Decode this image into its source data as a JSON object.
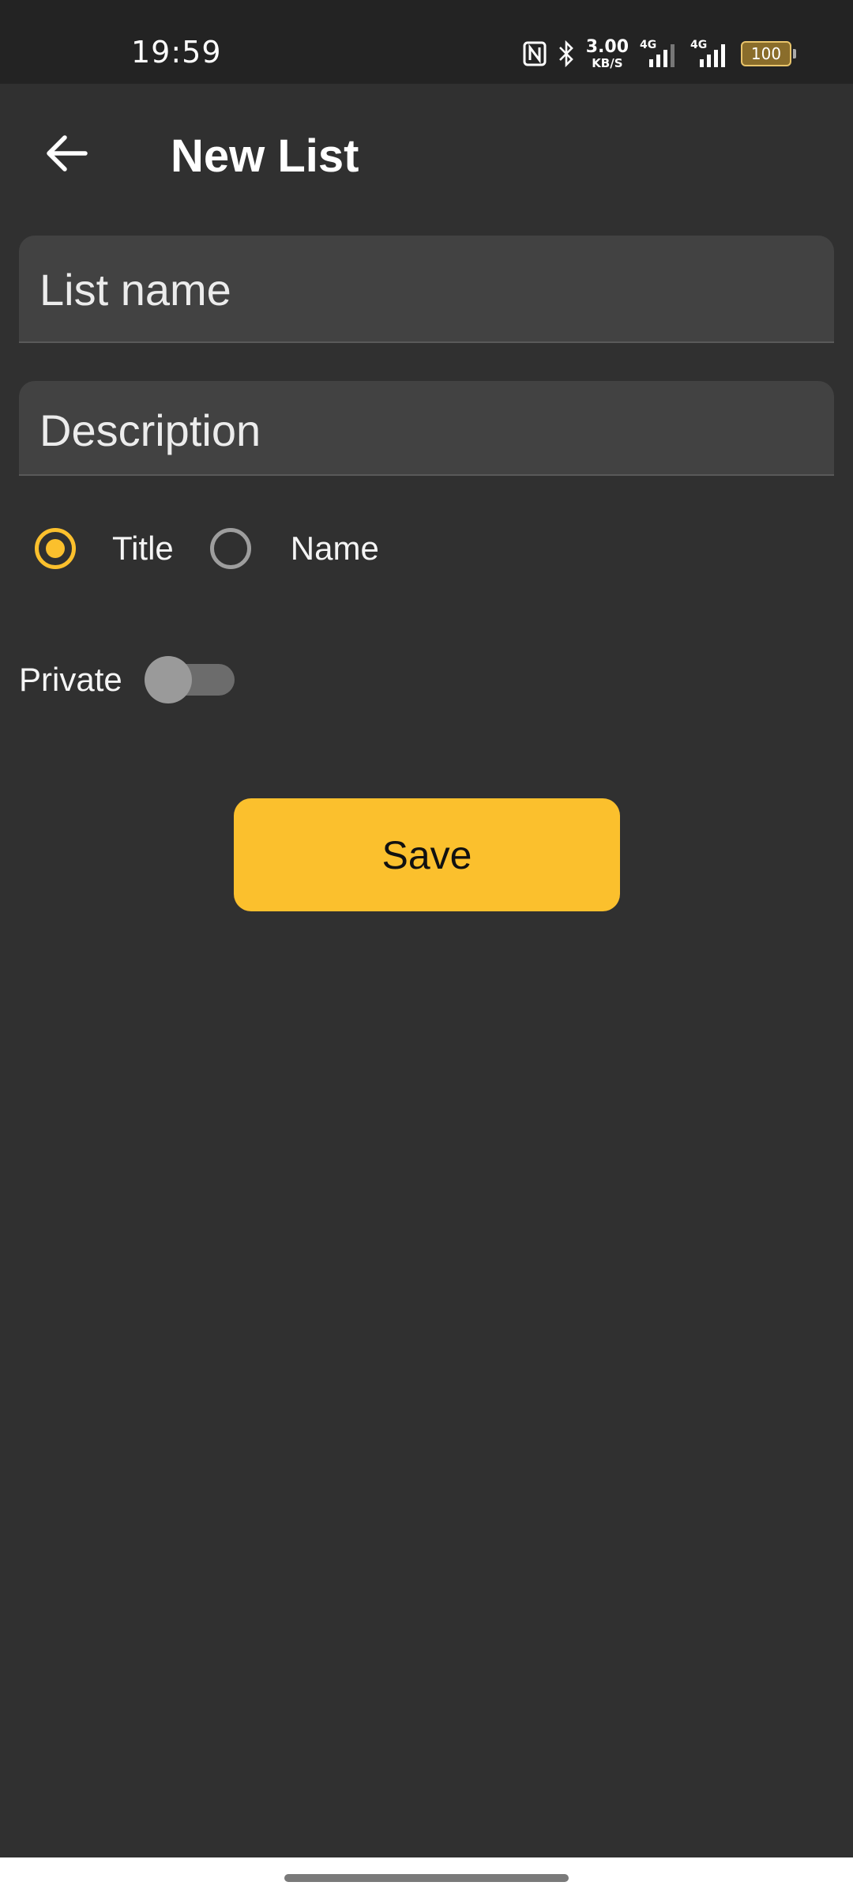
{
  "status_bar": {
    "time": "19:59",
    "net_speed_value": "3.00",
    "net_speed_unit": "KB/S",
    "sim1_gen": "4G",
    "sim2_gen": "4G",
    "battery_level": "100",
    "icons": [
      "nfc-icon",
      "bluetooth-icon",
      "data-arrows-icon",
      "signal-icon",
      "signal-icon",
      "battery-icon"
    ]
  },
  "app_bar": {
    "title": "New List",
    "back_icon": "arrow-left-icon"
  },
  "form": {
    "list_name_placeholder": "List name",
    "description_placeholder": "Description",
    "sort_options": [
      {
        "label": "Title",
        "selected": true
      },
      {
        "label": "Name",
        "selected": false
      }
    ],
    "private_label": "Private",
    "private_on": false,
    "save_label": "Save"
  },
  "colors": {
    "accent": "#fbc02d",
    "background": "#303030",
    "field": "#424242"
  }
}
